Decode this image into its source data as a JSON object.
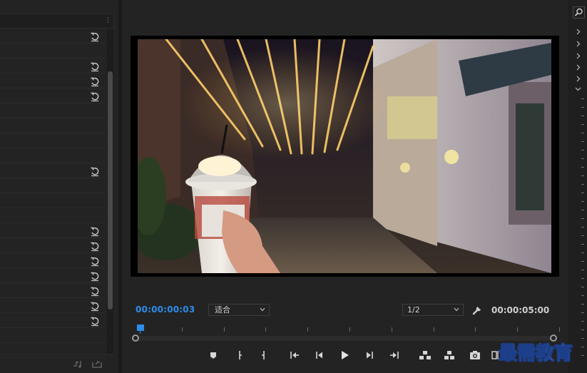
{
  "program_monitor": {
    "timecode_current": "00:00:00:03",
    "fit_select": {
      "value": "适合"
    },
    "resolution_select": {
      "value": "1/2"
    },
    "timecode_duration": "00:00:05:00",
    "playhead_position_fraction": 0.0,
    "video": {
      "description_icon": "video-frame"
    },
    "transport_buttons": [
      {
        "name": "add-marker-icon"
      },
      {
        "name": "mark-in-icon"
      },
      {
        "name": "mark-out-icon"
      },
      {
        "name": "go-to-in-icon"
      },
      {
        "name": "step-back-icon"
      },
      {
        "name": "play-icon"
      },
      {
        "name": "step-forward-icon"
      },
      {
        "name": "go-to-out-icon"
      },
      {
        "name": "lift-icon"
      },
      {
        "name": "extract-icon"
      },
      {
        "name": "export-frame-icon"
      },
      {
        "name": "comparison-view-icon"
      }
    ]
  },
  "effect_controls": {
    "reset_icon": "reset-icon",
    "rows": 22
  },
  "right_strip": {
    "search_icon": "search-icon",
    "chevrons": [
      "chevron-right-icon",
      "chevron-right-icon",
      "chevron-right-icon",
      "chevron-right-icon",
      "chevron-right-icon",
      "chevron-down-icon"
    ]
  },
  "watermark": {
    "text": "最需教育"
  },
  "colors": {
    "accent_blue": "#2d8ceb",
    "panel_bg": "#232323",
    "text_light": "#cfcfcf"
  }
}
